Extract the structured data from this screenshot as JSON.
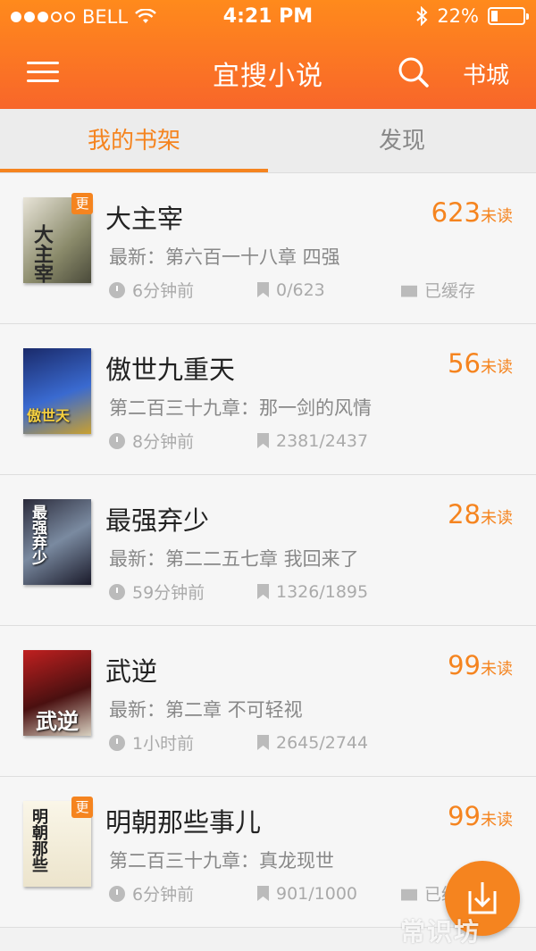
{
  "status_bar": {
    "carrier": "BELL",
    "time": "4:21 PM",
    "battery": "22%",
    "battery_level": 0.22
  },
  "navbar": {
    "title": "宜搜小说",
    "bookstore": "书城"
  },
  "tabs": {
    "bookshelf": "我的书架",
    "discover": "发现"
  },
  "books": [
    {
      "title": "大主宰",
      "cover_text": "大主宰",
      "unread_count": "623",
      "unread_label": "未读",
      "latest": "最新：第六百一十八章 四强",
      "time": "6分钟前",
      "progress": "0/623",
      "cached": "已缓存",
      "badge": "更"
    },
    {
      "title": "傲世九重天",
      "cover_text": "傲世天",
      "unread_count": "56",
      "unread_label": "未读",
      "latest": "第二百三十九章：那一剑的风情",
      "time": "8分钟前",
      "progress": "2381/2437"
    },
    {
      "title": "最强弃少",
      "cover_text": "最强弃少",
      "unread_count": "28",
      "unread_label": "未读",
      "latest": "最新：第二二五七章 我回来了",
      "time": "59分钟前",
      "progress": "1326/1895"
    },
    {
      "title": "武逆",
      "cover_text": "武逆",
      "unread_count": "99",
      "unread_label": "未读",
      "latest": "最新：第二章 不可轻视",
      "time": "1小时前",
      "progress": "2645/2744"
    },
    {
      "title": "明朝那些事儿",
      "cover_text": "明朝那些",
      "unread_count": "99",
      "unread_label": "未读",
      "latest": "第二百三十九章：真龙现世",
      "time": "6分钟前",
      "progress": "901/1000",
      "cached": "已缓存",
      "badge": "更"
    }
  ],
  "watermark": "常识坊",
  "colors": {
    "accent": "#f5841f",
    "header_top": "#ff8a1c",
    "header_bottom": "#f8662a"
  }
}
